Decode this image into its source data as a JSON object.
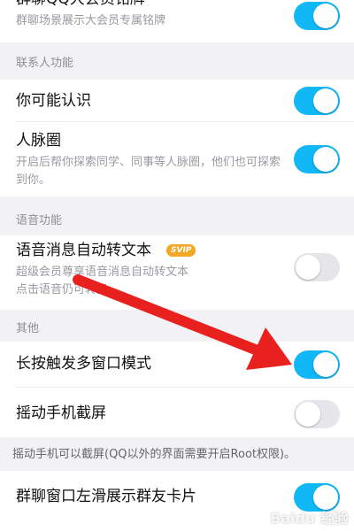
{
  "rows": {
    "badge": {
      "title": "群聊QQ大会员铭牌",
      "desc": "群聊场景展示大会员专属铭牌",
      "on": true
    },
    "may_know": {
      "title": "你可能认识",
      "on": true
    },
    "network": {
      "title": "人脉圈",
      "desc": "开启后帮你探索同学、同事等人脉圈，他们也可探索到你。",
      "on": true
    },
    "voice_to_text": {
      "title": "语音消息自动转文本",
      "badge": "SVIP",
      "desc": "超级会员尊享语音消息自动转文本\n点击语音仍可转换",
      "on": false
    },
    "multiwindow": {
      "title": "长按触发多窗口模式",
      "on": true
    },
    "shake_screenshot": {
      "title": "摇动手机截屏",
      "on": false
    },
    "group_card": {
      "title": "群聊窗口左滑展示群友卡片",
      "on": true
    }
  },
  "sections": {
    "contacts": "联系人功能",
    "voice": "语音功能",
    "other": "其他"
  },
  "notes": {
    "shake": "摇动手机可以截屏(QQ以外的界面需要开启Root权限)。"
  },
  "watermark": "Baidu 经验",
  "colors": {
    "toggle_on": "#12b7f5",
    "toggle_off": "#e5e5ea",
    "arrow": "#e8201e"
  }
}
